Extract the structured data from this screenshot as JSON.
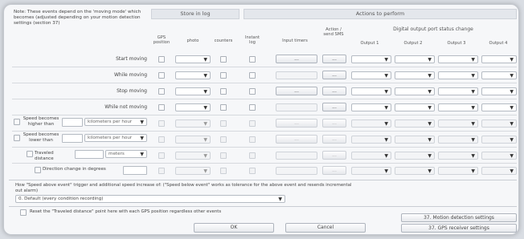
{
  "intro_text": "Note: These events depend on the 'moving mode' which becomes (adjusted depending on your motion detection settings (section 37)",
  "header": {
    "store_in_log": "Store in log",
    "actions": "Actions to perform",
    "digital_output": "Digital output port status change"
  },
  "columns": {
    "gps_position": "GPS position",
    "photo": "photo",
    "counters": "counters",
    "instant_log": "Instant log",
    "input_timers": "Input timers",
    "action_send_sms": "Action / send SMS",
    "output1": "Output 1",
    "output2": "Output 2",
    "output3": "Output 3",
    "output4": "Output 4"
  },
  "rows": {
    "start_moving": "Start moving",
    "while_moving": "While moving",
    "stop_moving": "Stop moving",
    "while_not_moving": "While not moving",
    "speed_higher": "Speed becomes higher than",
    "speed_lower": "Speed becomes lower than",
    "traveled_distance": "Traveled distance",
    "direction_change": "Direction change in degrees"
  },
  "units": {
    "speed_higher": "kilometers per hour",
    "speed_lower": "kilometers per hour",
    "distance": "meters"
  },
  "ellipsis": "...",
  "note2": "How \"Speed above event\" trigger and additional speed increase of: (\"Speed below event\" works as tolerance for the above event and resends incremental out alarm)",
  "note2_select": "0. Default (every condition recording)",
  "reset_text": "Reset the \"Traveled distance\" point here with each GPS position regardless other events",
  "buttons": {
    "motion_detection": "37. Motion detection settings",
    "gps_receiver": "37. GPS receiver settings",
    "ok": "OK",
    "cancel": "Cancel"
  }
}
